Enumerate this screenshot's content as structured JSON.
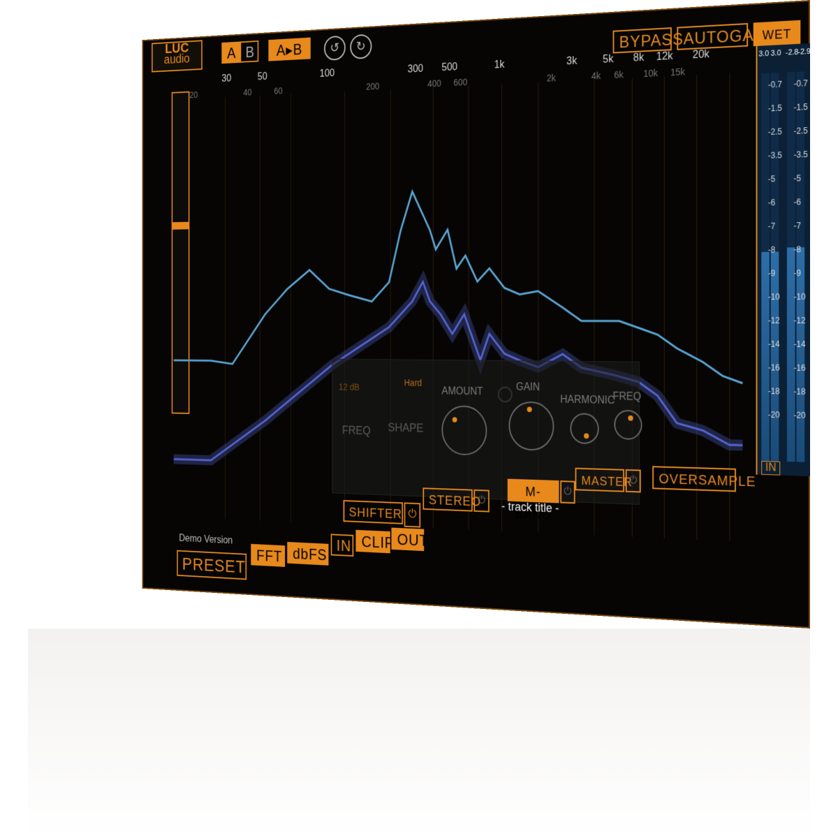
{
  "logo": {
    "line1": "LUC",
    "line2": "audio"
  },
  "ab": {
    "a": "A",
    "b": "B",
    "atob": "A▸B"
  },
  "top_right": {
    "bypass": "BYPASS",
    "autogain": "AUTOGAIN",
    "wet": "WET"
  },
  "freq_major": [
    "30",
    "50",
    "100",
    "300",
    "500",
    "1k",
    "3k",
    "5k",
    "8k",
    "12k",
    "20k"
  ],
  "freq_minor": [
    "20",
    "40",
    "60",
    "200",
    "400",
    "600",
    "2k",
    "4k",
    "6k",
    "10k",
    "15k"
  ],
  "panel": {
    "db": "12 dB",
    "hard": "Hard",
    "freq": "FREQ",
    "shape": "SHAPE",
    "amount": "AMOUNT",
    "gain": "GAIN",
    "harmonic": "HARMONIC",
    "freq2": "FREQ"
  },
  "modules": {
    "shifter": "SHIFTER",
    "stereo": "STEREO",
    "mband": "M-BAND",
    "master": "MASTER",
    "oversample": "OVERSAMPLE",
    "track": "- track title -"
  },
  "bottom": {
    "demo": "Demo Version",
    "preset": "PRESET",
    "fft": "FFT",
    "dbfs": "dbFS",
    "in": "IN",
    "clip": "CLIP",
    "out": "OUT"
  },
  "meter": {
    "in_label": "IN",
    "peak_left": [
      "3.0",
      "3.0"
    ],
    "peak_right": [
      "-2.8",
      "-2.9"
    ],
    "scale": [
      "-0.7",
      "-1.5",
      "-2.5",
      "-3.5",
      "-5",
      "-6",
      "-7",
      "-8",
      "-9",
      "-10",
      "-12",
      "-14",
      "-16",
      "-18",
      "-20"
    ],
    "in_level": 0.54,
    "out_level": 0.55
  },
  "colors": {
    "accent": "#e8891c",
    "spectrum_light": "#58a9d8",
    "spectrum_dark": "#4b56c4",
    "meter": "#2d6ea8"
  }
}
